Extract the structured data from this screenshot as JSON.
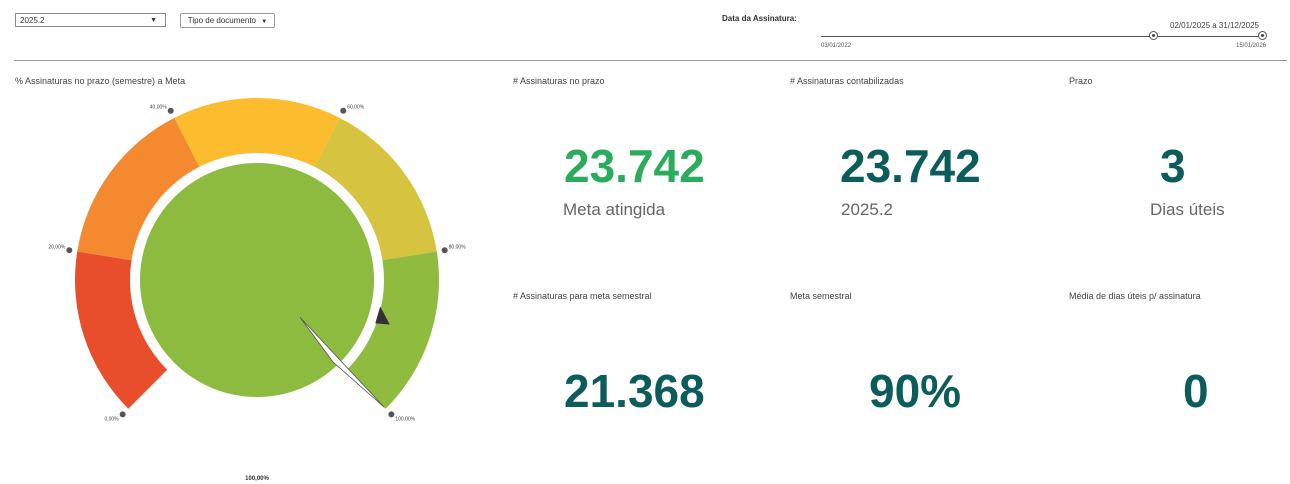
{
  "filters": {
    "period_select": "2025.2",
    "doc_type_button": "Tipo de documento",
    "date_label": "Data da Assinatura:",
    "date_range_value": "02/01/2025 a 31/12/2025",
    "slider_min": "03/01/2022",
    "slider_max": "15/01/2026"
  },
  "gauge": {
    "title": "% Assinaturas no prazo (semestre) a Meta",
    "ticks": [
      "0,00%",
      "20,00%",
      "40,00%",
      "60,00%",
      "80,00%",
      "100,00%"
    ],
    "value_label": "100,00%",
    "value_percent": 100,
    "target_percent": 90,
    "band_colors": [
      "#e84e2c",
      "#f4892f",
      "#fbbd2e",
      "#d6c33f",
      "#8fbb3f"
    ],
    "center_color": "#8dbb40"
  },
  "cards": {
    "no_prazo": {
      "title": "# Assinaturas no prazo",
      "value": "23.742",
      "sub": "Meta atingida",
      "color": "#2bab5c"
    },
    "contabilizadas": {
      "title": "#  Assinaturas contabilizadas",
      "value": "23.742",
      "sub": "2025.2",
      "color": "#0c5c5b"
    },
    "prazo": {
      "title": "Prazo",
      "value": "3",
      "sub": "Dias úteis",
      "color": "#0c5c5b"
    },
    "meta_semestral_count": {
      "title": "# Assinaturas para meta semestral",
      "value": "21.368",
      "color": "#0c5c5b"
    },
    "meta_semestral": {
      "title": "Meta semestral",
      "value": "90%",
      "color": "#0c5c5b"
    },
    "media_dias": {
      "title": "Média de dias úteis p/ assinatura",
      "value": "0",
      "color": "#0c5c5b"
    }
  }
}
